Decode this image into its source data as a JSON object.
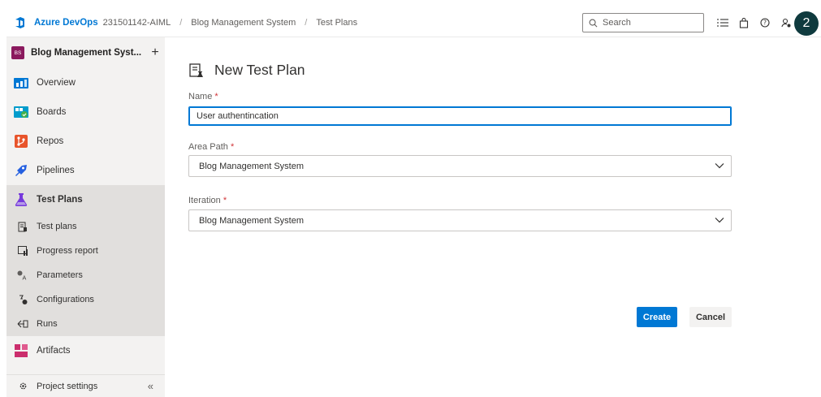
{
  "topbar": {
    "brand": "Azure DevOps",
    "breadcrumbs": [
      "231501142-AIML",
      "Blog Management System",
      "Test Plans"
    ],
    "separator": "/",
    "search_placeholder": "Search",
    "avatar_text": "2"
  },
  "sidebar": {
    "project_badge": "BS",
    "project_name": "Blog Management Syst...",
    "add_label": "+",
    "items": [
      {
        "label": "Overview",
        "icon": "overview-icon"
      },
      {
        "label": "Boards",
        "icon": "boards-icon"
      },
      {
        "label": "Repos",
        "icon": "repos-icon"
      },
      {
        "label": "Pipelines",
        "icon": "pipelines-icon"
      },
      {
        "label": "Test Plans",
        "icon": "test-plans-icon"
      },
      {
        "label": "Artifacts",
        "icon": "artifacts-icon"
      }
    ],
    "sub_items": [
      {
        "label": "Test plans",
        "icon": "test-plans-list-icon"
      },
      {
        "label": "Progress report",
        "icon": "progress-report-icon"
      },
      {
        "label": "Parameters",
        "icon": "parameters-icon"
      },
      {
        "label": "Configurations",
        "icon": "configurations-icon"
      },
      {
        "label": "Runs",
        "icon": "runs-icon"
      }
    ],
    "settings_label": "Project settings",
    "collapse_label": "«"
  },
  "form": {
    "title": "New Test Plan",
    "name_label": "Name",
    "name_value": "User authentincation",
    "area_label": "Area Path",
    "area_value": "Blog Management System",
    "iteration_label": "Iteration",
    "iteration_value": "Blog Management System",
    "required_mark": "*",
    "create_label": "Create",
    "cancel_label": "Cancel"
  },
  "colors": {
    "accent": "#0078d4",
    "sidebar_bg": "#f3f2f1",
    "active_bg": "#e1dfdd",
    "avatar_bg": "#0f3a3e"
  }
}
